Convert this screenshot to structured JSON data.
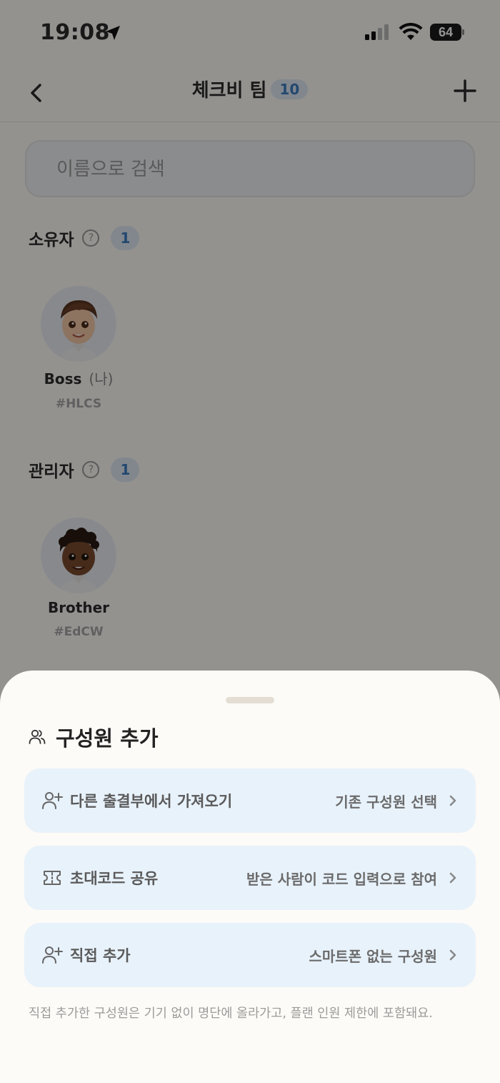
{
  "status_bar": {
    "time": "19:08",
    "battery": "64"
  },
  "header": {
    "title": "체크비 팀",
    "count": "10"
  },
  "search": {
    "placeholder": "이름으로 검색"
  },
  "sections": {
    "owners": {
      "label": "소유자",
      "count": "1",
      "members": [
        {
          "name": "Boss",
          "me_tag": "(나)",
          "code": "#HLCS"
        }
      ]
    },
    "admins": {
      "label": "관리자",
      "count": "1",
      "members": [
        {
          "name": "Brother",
          "code": "#EdCW"
        }
      ]
    }
  },
  "sheet": {
    "title": "구성원 추가",
    "options": [
      {
        "label": "다른 출결부에서 가져오기",
        "detail": "기존 구성원 선택",
        "icon": "user-plus-icon"
      },
      {
        "label": "초대코드 공유",
        "detail": "받은 사람이 코드 입력으로 참여",
        "icon": "ticket-icon"
      },
      {
        "label": "직접 추가",
        "detail": "스마트폰 없는 구성원",
        "icon": "user-plus-icon"
      }
    ],
    "note": "직접 추가한 구성원은 기기 없이 명단에 올라가고, 플랜 인원 제한에 포함돼요."
  },
  "colors": {
    "accent": "#3d7cc2",
    "badge_bg": "#dfe9f3",
    "option_bg": "#e8f2fb",
    "overlay": "rgba(0,0,0,0.42)"
  }
}
